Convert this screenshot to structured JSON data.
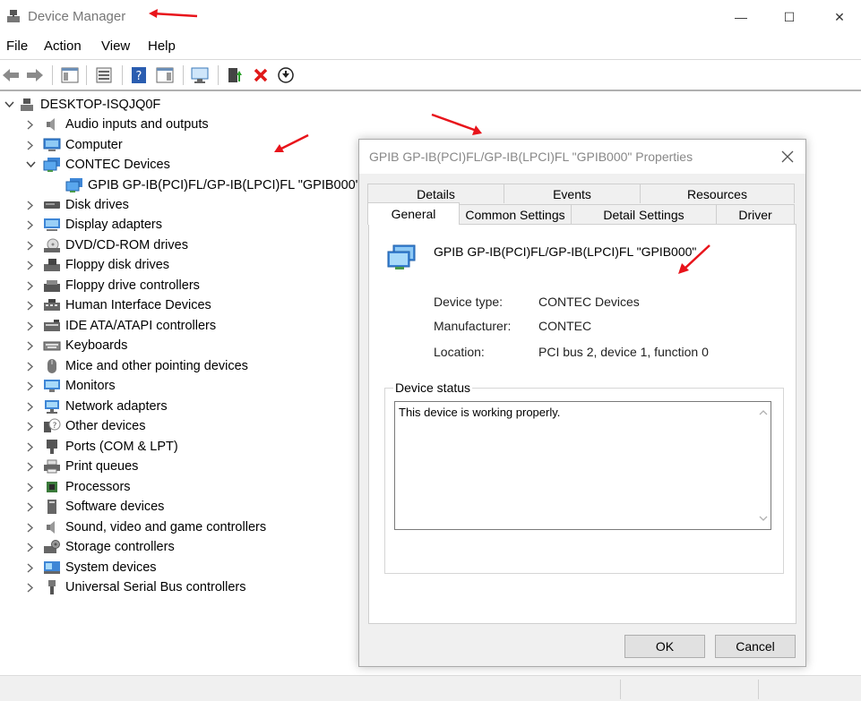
{
  "window": {
    "title": "Device Manager",
    "controls": {
      "minimize": "—",
      "maximize": "☐",
      "close": "✕"
    }
  },
  "menu": [
    "File",
    "Action",
    "View",
    "Help"
  ],
  "toolbar": {
    "buttons": [
      "back-icon",
      "forward-icon",
      "show-hide-console-tree-icon",
      "properties-icon",
      "help-icon",
      "action-pane-icon",
      "scan-hardware-icon",
      "update-driver-icon",
      "uninstall-icon",
      "disable-device-icon"
    ]
  },
  "tree": {
    "root": "DESKTOP-ISQJQ0F",
    "expanded_child": "GPIB GP-IB(PCI)FL/GP-IB(LPCI)FL \"GPIB000\"",
    "items": [
      "Audio inputs and outputs",
      "Computer",
      "CONTEC Devices",
      "Disk drives",
      "Display adapters",
      "DVD/CD-ROM drives",
      "Floppy disk drives",
      "Floppy drive controllers",
      "Human Interface Devices",
      "IDE ATA/ATAPI controllers",
      "Keyboards",
      "Mice and other pointing devices",
      "Monitors",
      "Network adapters",
      "Other devices",
      "Ports (COM & LPT)",
      "Print queues",
      "Processors",
      "Software devices",
      "Sound, video and game controllers",
      "Storage controllers",
      "System devices",
      "Universal Serial Bus controllers"
    ]
  },
  "dialog": {
    "title": "GPIB GP-IB(PCI)FL/GP-IB(LPCI)FL \"GPIB000\" Properties",
    "tabs_row1": [
      "Details",
      "Events",
      "Resources"
    ],
    "tabs_row2": [
      "General",
      "Common Settings",
      "Detail Settings",
      "Driver"
    ],
    "device_name": "GPIB GP-IB(PCI)FL/GP-IB(LPCI)FL \"GPIB000\"",
    "props": {
      "type_label": "Device type:",
      "type_value": "CONTEC Devices",
      "mfr_label": "Manufacturer:",
      "mfr_value": "CONTEC",
      "loc_label": "Location:",
      "loc_value": "PCI bus 2, device 1, function 0"
    },
    "status_group_label": "Device status",
    "status_text": "This device is working properly.",
    "ok_label": "OK",
    "cancel_label": "Cancel"
  },
  "colors": {
    "annotation_red": "#e8141b",
    "accent_blue": "#1e7fd6"
  }
}
